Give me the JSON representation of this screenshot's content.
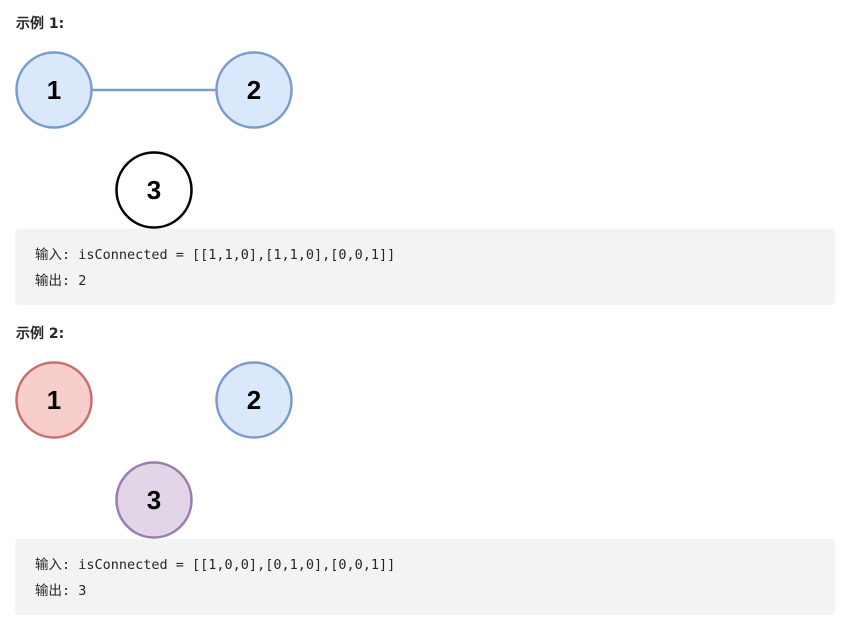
{
  "examples": [
    {
      "heading": "示例 1:",
      "graph": {
        "nodes": [
          {
            "label": "1",
            "fill": "#dae8fc",
            "stroke": "#7a9ccc"
          },
          {
            "label": "2",
            "fill": "#dae8fc",
            "stroke": "#7a9ccc"
          },
          {
            "label": "3",
            "fill": "#ffffff",
            "stroke": "#000000"
          }
        ],
        "edges": [
          [
            "1",
            "2"
          ]
        ],
        "edge_color": "#7a9ccc"
      },
      "input_line": "输入: isConnected = [[1,1,0],[1,1,0],[0,0,1]]",
      "output_line": "输出: 2"
    },
    {
      "heading": "示例 2:",
      "graph": {
        "nodes": [
          {
            "label": "1",
            "fill": "#f8cecc",
            "stroke": "#c8706b"
          },
          {
            "label": "2",
            "fill": "#dae8fc",
            "stroke": "#7a9ccc"
          },
          {
            "label": "3",
            "fill": "#e1d5e7",
            "stroke": "#9a7dad"
          }
        ],
        "edges": []
      },
      "input_line": "输入: isConnected = [[1,0,0],[0,1,0],[0,0,1]]",
      "output_line": "输出: 3"
    }
  ]
}
